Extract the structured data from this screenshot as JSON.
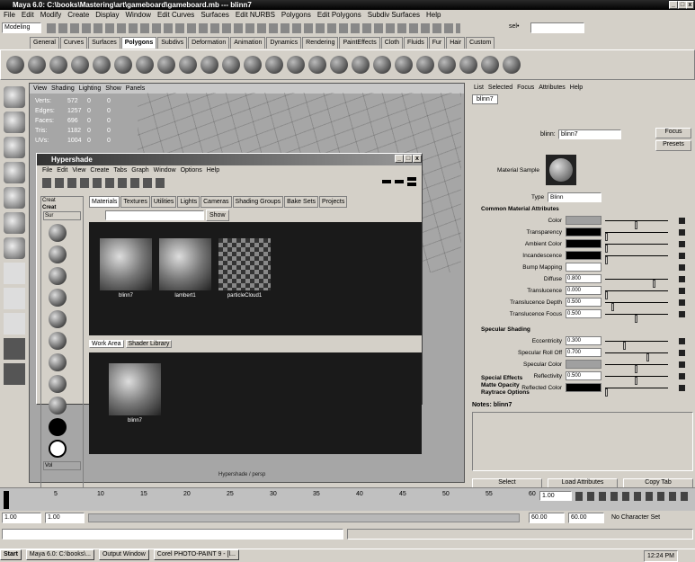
{
  "window": {
    "title": "Maya 6.0: C:\\books\\Mastering\\art\\gameboard\\gameboard.mb   ---   blinn7"
  },
  "main_menu": [
    "File",
    "Edit",
    "Modify",
    "Create",
    "Display",
    "Window",
    "Edit Curves",
    "Surfaces",
    "Edit NURBS",
    "Polygons",
    "Edit Polygons",
    "Subdiv Surfaces",
    "Help"
  ],
  "status_line": {
    "mode": "Modeling",
    "sel_label": "sel•"
  },
  "shelf_tabs": [
    "General",
    "Curves",
    "Surfaces",
    "Polygons",
    "Subdivs",
    "Deformation",
    "Animation",
    "Dynamics",
    "Rendering",
    "PaintEffects",
    "Cloth",
    "Fluids",
    "Fur",
    "Hair",
    "Custom"
  ],
  "shelf_active": "Polygons",
  "viewport": {
    "menu": [
      "View",
      "Shading",
      "Lighting",
      "Show",
      "Panels"
    ],
    "hud": [
      {
        "label": "Verts:",
        "v1": "572",
        "v2": "0",
        "v3": "0"
      },
      {
        "label": "Edges:",
        "v1": "1257",
        "v2": "0",
        "v3": "0"
      },
      {
        "label": "Faces:",
        "v1": "696",
        "v2": "0",
        "v3": "0"
      },
      {
        "label": "Tris:",
        "v1": "1182",
        "v2": "0",
        "v3": "0"
      },
      {
        "label": "UVs:",
        "v1": "1004",
        "v2": "0",
        "v3": "0"
      }
    ],
    "camera": "Hypershade / persp"
  },
  "hypershade": {
    "title": "Hypershade",
    "menu": [
      "File",
      "Edit",
      "View",
      "Create",
      "Tabs",
      "Graph",
      "Window",
      "Options",
      "Help"
    ],
    "left_tabs": [
      "Creat",
      "Creat"
    ],
    "left_section": "Sur",
    "left_bottom": "Vol",
    "top_tabs": [
      "Materials",
      "Textures",
      "Utilities",
      "Lights",
      "Cameras",
      "Shading Groups",
      "Bake Sets",
      "Projects"
    ],
    "show_btn": "Show",
    "materials": [
      {
        "name": "blinn7",
        "kind": "sphere"
      },
      {
        "name": "lambert1",
        "kind": "sphere"
      },
      {
        "name": "particleCloud1",
        "kind": "checker"
      }
    ],
    "bottom_tabs": [
      "Work Area",
      "Shader Library"
    ],
    "work_node": "blinn7"
  },
  "attribute_editor": {
    "menu": [
      "List",
      "Selected",
      "Focus",
      "Attributes",
      "Help"
    ],
    "tab": "blinn7",
    "node_label": "blinn:",
    "node_value": "blinn7",
    "focus_btn": "Focus",
    "presets_btn": "Presets",
    "sample_label": "Material Sample",
    "type_label": "Type",
    "type_value": "Blinn",
    "common_section": "Common Material Attributes",
    "common_rows": [
      {
        "label": "Color",
        "value": "",
        "swatch": "#a0a0a0",
        "slider": 0.5
      },
      {
        "label": "Transparency",
        "value": "",
        "swatch": "#000000",
        "slider": 0.0
      },
      {
        "label": "Ambient Color",
        "value": "",
        "swatch": "#000000",
        "slider": 0.0
      },
      {
        "label": "Incandescence",
        "value": "",
        "swatch": "#000000",
        "slider": 0.0
      },
      {
        "label": "Bump Mapping",
        "value": "",
        "swatch": "",
        "slider": -1
      },
      {
        "label": "Diffuse",
        "value": "0.800",
        "swatch": "",
        "slider": 0.8
      },
      {
        "label": "Translucence",
        "value": "0.000",
        "swatch": "",
        "slider": 0.0
      },
      {
        "label": "Translucence Depth",
        "value": "0.500",
        "swatch": "",
        "slider": 0.1
      },
      {
        "label": "Translucence Focus",
        "value": "0.500",
        "swatch": "",
        "slider": 0.5
      }
    ],
    "spec_section": "Specular Shading",
    "spec_rows": [
      {
        "label": "Eccentricity",
        "value": "0.300",
        "swatch": "",
        "slider": 0.3
      },
      {
        "label": "Specular Roll Off",
        "value": "0.700",
        "swatch": "",
        "slider": 0.7
      },
      {
        "label": "Specular Color",
        "value": "",
        "swatch": "#a0a0a0",
        "slider": 0.5
      },
      {
        "label": "Reflectivity",
        "value": "0.500",
        "swatch": "",
        "slider": 0.5
      },
      {
        "label": "Reflected Color",
        "value": "",
        "swatch": "#000000",
        "slider": 0.0
      }
    ],
    "collapsed_sections": [
      "Special Effects",
      "Matte Opacity",
      "Raytrace Options"
    ],
    "notes": "Notes: blinn7",
    "buttons": [
      "Select",
      "Load Attributes",
      "Copy Tab"
    ]
  },
  "timeline": {
    "ticks": [
      "5",
      "10",
      "15",
      "20",
      "25",
      "30",
      "35",
      "40",
      "45",
      "50",
      "55",
      "60"
    ],
    "current_frame": "1.00"
  },
  "range": {
    "start": "1.00",
    "inner_start": "1.00",
    "inner_end": "60.00",
    "end": "60.00",
    "character_set": "No Character Set"
  },
  "taskbar": {
    "start": "Start",
    "tasks": [
      "Maya 6.0: C:\\books\\...",
      "Output Window",
      "Corel PHOTO-PAINT 9 - [l..."
    ],
    "clock": "12:24 PM"
  }
}
